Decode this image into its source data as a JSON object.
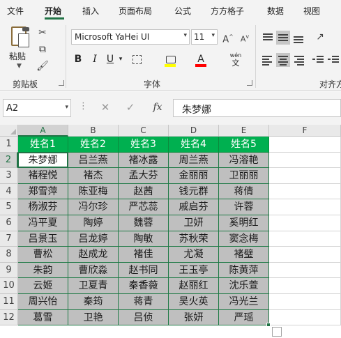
{
  "ribbon_tabs": [
    "文件",
    "开始",
    "插入",
    "页面布局",
    "公式",
    "方方格子",
    "数据",
    "视图"
  ],
  "active_tab": "开始",
  "clipboard": {
    "paste_label": "粘贴",
    "group_label": "剪贴板"
  },
  "font": {
    "family": "Microsoft YaHei UI",
    "size": "11",
    "group_label": "字体",
    "phonetic_label": "wén"
  },
  "alignment": {
    "group_label": "对齐方"
  },
  "formula_bar": {
    "name_box": "A2",
    "formula": "朱梦娜"
  },
  "sheet": {
    "columns": [
      "A",
      "B",
      "C",
      "D",
      "E",
      "F"
    ],
    "rows": [
      "1",
      "2",
      "3",
      "4",
      "5",
      "6",
      "7",
      "8",
      "9",
      "10",
      "11",
      "12"
    ],
    "header_row": [
      "姓名1",
      "姓名2",
      "姓名3",
      "姓名4",
      "姓名5"
    ],
    "data": [
      [
        "朱梦娜",
        "吕兰燕",
        "褚冰露",
        "周兰燕",
        "冯溶艳"
      ],
      [
        "褚程悦",
        "褚杰",
        "孟大芬",
        "金丽丽",
        "卫丽丽"
      ],
      [
        "郑雪萍",
        "陈亚梅",
        "赵茜",
        "钱元群",
        "蒋倩"
      ],
      [
        "杨淑芬",
        "冯尔珍",
        "严芯蕊",
        "戚启芬",
        "许蓉"
      ],
      [
        "冯平夏",
        "陶婷",
        "魏蓉",
        "卫妍",
        "奚明红"
      ],
      [
        "吕景玉",
        "吕龙婷",
        "陶敏",
        "苏秋荣",
        "窦念梅"
      ],
      [
        "曹松",
        "赵成龙",
        "褚佳",
        "尤凝",
        "褚璧"
      ],
      [
        "朱韵",
        "曹欣淼",
        "赵书同",
        "王玉亭",
        "陈黄萍"
      ],
      [
        "云姬",
        "卫夏青",
        "秦香薇",
        "赵丽红",
        "沈乐萱"
      ],
      [
        "周兴怡",
        "秦筠",
        "蒋青",
        "吴火英",
        "冯光兰"
      ],
      [
        "葛雪",
        "卫艳",
        "吕侦",
        "张妍",
        "严瑶"
      ]
    ],
    "active_cell": "A2",
    "colors": {
      "header_fill": "#00b050",
      "data_fill": "#bfbfbf",
      "border": "#1e7a45",
      "accent": "#217346"
    }
  }
}
